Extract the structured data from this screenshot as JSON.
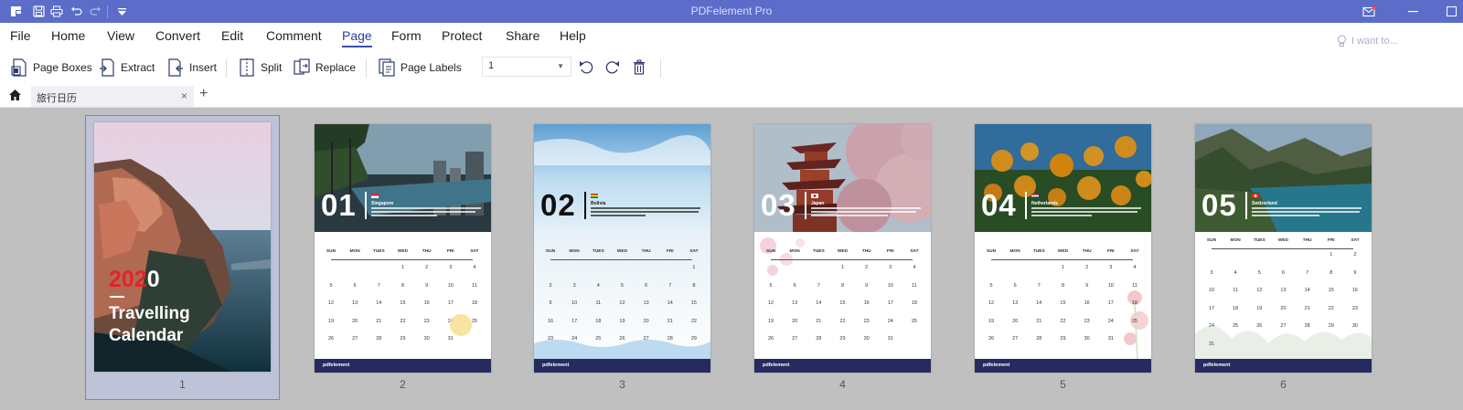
{
  "app": {
    "title": "PDFelement Pro"
  },
  "menu": {
    "items": [
      "File",
      "Home",
      "View",
      "Convert",
      "Edit",
      "Comment",
      "Page",
      "Form",
      "Protect",
      "Share",
      "Help"
    ],
    "active": "Page",
    "i_want_to": "I want to..."
  },
  "toolbar": {
    "page_boxes": "Page Boxes",
    "extract": "Extract",
    "insert": "Insert",
    "split": "Split",
    "replace": "Replace",
    "page_labels": "Page Labels",
    "page_select_value": "1"
  },
  "tab": {
    "name": "旅行日历"
  },
  "thumbnails": {
    "cover": {
      "year_red": "202",
      "year_white": "0",
      "title_line1": "Travelling",
      "title_line2": "Calendar",
      "label": "1"
    },
    "pages": [
      {
        "num": "01",
        "city": "Singapore",
        "label": "2",
        "dark": false
      },
      {
        "num": "02",
        "city": "Bolivia",
        "label": "3",
        "dark": true
      },
      {
        "num": "03",
        "city": "Japan",
        "label": "4",
        "dark": false
      },
      {
        "num": "04",
        "city": "Netherlands",
        "label": "5",
        "dark": false
      },
      {
        "num": "05",
        "city": "Switzerland",
        "label": "6",
        "dark": false
      }
    ],
    "weekdays": [
      "SUN",
      "MON",
      "TUES",
      "WED",
      "THU",
      "FRI",
      "SAT"
    ],
    "footer_brand": "pdfelement"
  },
  "colors": {
    "titlebar": "#5b6dc8",
    "accent": "#3b4eae",
    "canvas": "#c0c0c0",
    "footer": "#252b5e",
    "cover_year": "#e0242c"
  }
}
